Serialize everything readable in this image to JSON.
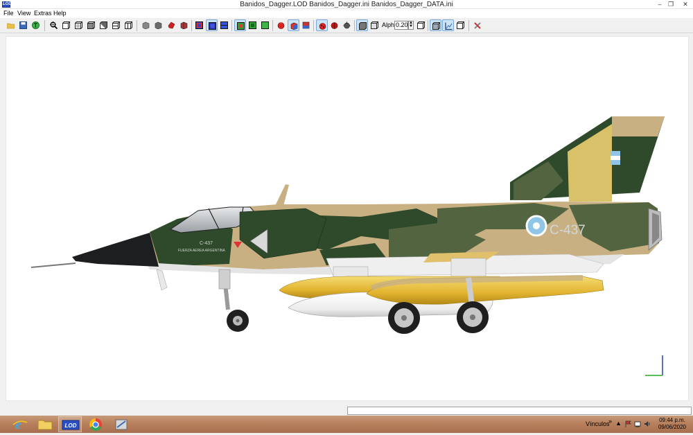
{
  "window": {
    "title": "Banidos_Dagger.LOD  Banidos_Dagger.ini  Banidos_Dagger_DATA.ini",
    "app_icon_text": "LOD",
    "minimize": "–",
    "maximize": "❐",
    "close": "✕"
  },
  "menu": [
    "File",
    "View",
    "Extras",
    "Help"
  ],
  "toolbar": {
    "alpha_label": "Alpha:",
    "alpha_value": "0.20",
    "icons": [
      "open-folder-icon",
      "save-icon",
      "text-t-icon",
      "zoom-icon",
      "box-view-1-icon",
      "box-view-2-icon",
      "box-view-3-icon",
      "box-view-4-icon",
      "box-view-5-icon",
      "box-view-6-icon",
      "gray-cube-1-icon",
      "gray-cube-2-icon",
      "red-object-icon",
      "cube-dark-icon",
      "blue-cube-1-icon",
      "blue-cube-2-icon",
      "blue-cube-3-icon",
      "green-cube-1-icon",
      "green-cube-2-icon",
      "green-cube-3-icon",
      "red-apple-icon",
      "color-cube-icon",
      "book-icon",
      "ladybug-1-icon",
      "ladybug-2-icon",
      "gear-dark-icon",
      "solid-box-icon",
      "wire-box-icon",
      "wire-box-2-icon",
      "shaded-box-icon",
      "axis-graph-icon",
      "box-outline-icon",
      "tools-icon"
    ]
  },
  "aircraft": {
    "serial": "C-437",
    "small_serial": "C-437",
    "small_text": "FUERZA AEREA ARGENTINA"
  },
  "colors": {
    "camo_green": "#2f4a2b",
    "camo_tan": "#c8b083",
    "camo_olive": "#536440",
    "tail_yellow": "#d9c169",
    "tank_yellow": "#e0b431",
    "nose_black": "#1c1e20",
    "taskbar": "#b8805d"
  },
  "taskbar": {
    "apps": [
      "ie-icon",
      "explorer-icon",
      "lod-app-icon",
      "chrome-icon",
      "tool-app-icon"
    ],
    "lod_label": "LOD",
    "vinculos": "Vínculos",
    "tray_arrow": "»",
    "time": "09:44 p.m.",
    "date": "09/06/2020"
  }
}
